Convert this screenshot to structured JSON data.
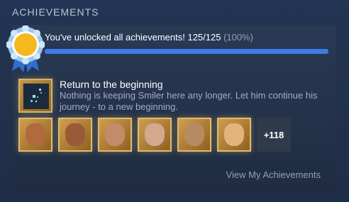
{
  "section": {
    "title": "ACHIEVEMENTS"
  },
  "progress": {
    "text": "You've unlocked all achievements! 125/125",
    "percent_text": "(100%)",
    "fraction": 1.0
  },
  "featured": {
    "title": "Return to the beginning",
    "description": "Nothing is keeping Smiler here any longer. Let him continue his journey - to a new beginning."
  },
  "thumbnails": [
    {
      "icon": "two-faces-icon",
      "face": "#b06a3e"
    },
    {
      "icon": "two-faces-icon",
      "face": "#9a5a3a"
    },
    {
      "icon": "helmet-face-icon",
      "face": "#c28b6a"
    },
    {
      "icon": "old-man-icon",
      "face": "#d2a98d"
    },
    {
      "icon": "gears-face-icon",
      "face": "#b68a62"
    },
    {
      "icon": "woman-face-icon",
      "face": "#e2b47c"
    }
  ],
  "more_count": "+118",
  "view_link": "View My Achievements",
  "colors": {
    "accent": "#3d7be6",
    "gold": "#e0bb70"
  }
}
